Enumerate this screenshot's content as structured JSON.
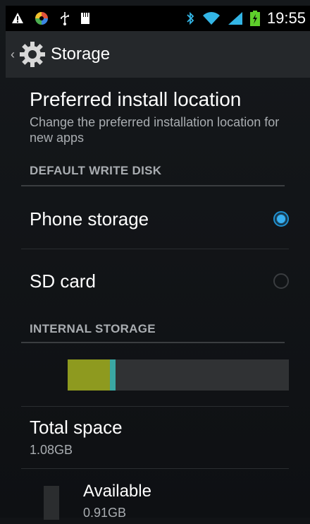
{
  "status_bar": {
    "time": "19:55",
    "icons": [
      "warning-icon",
      "sync-icon",
      "usb-icon",
      "storage-icon",
      "bluetooth-icon",
      "wifi-icon",
      "signal-icon",
      "battery-icon"
    ],
    "accent": "#33b5e5"
  },
  "action_bar": {
    "title": "Storage",
    "icon": "settings-gear-icon"
  },
  "preferred_install": {
    "title": "Preferred install location",
    "summary": "Change the preferred installation location for new apps"
  },
  "default_write_disk": {
    "header": "DEFAULT WRITE DISK",
    "options": [
      {
        "label": "Phone storage",
        "selected": true
      },
      {
        "label": "SD card",
        "selected": false
      }
    ]
  },
  "internal_storage": {
    "header": "INTERNAL STORAGE",
    "usage_bar": {
      "apps_fraction": 0.19,
      "other_fraction": 0.025
    },
    "total": {
      "label": "Total space",
      "value": "1.08GB"
    },
    "available": {
      "label": "Available",
      "value": "0.91GB"
    }
  },
  "colors": {
    "selected_radio": "#39b0f2",
    "apps_segment": "#8e9a1f",
    "other_segment": "#3aa7a3"
  }
}
